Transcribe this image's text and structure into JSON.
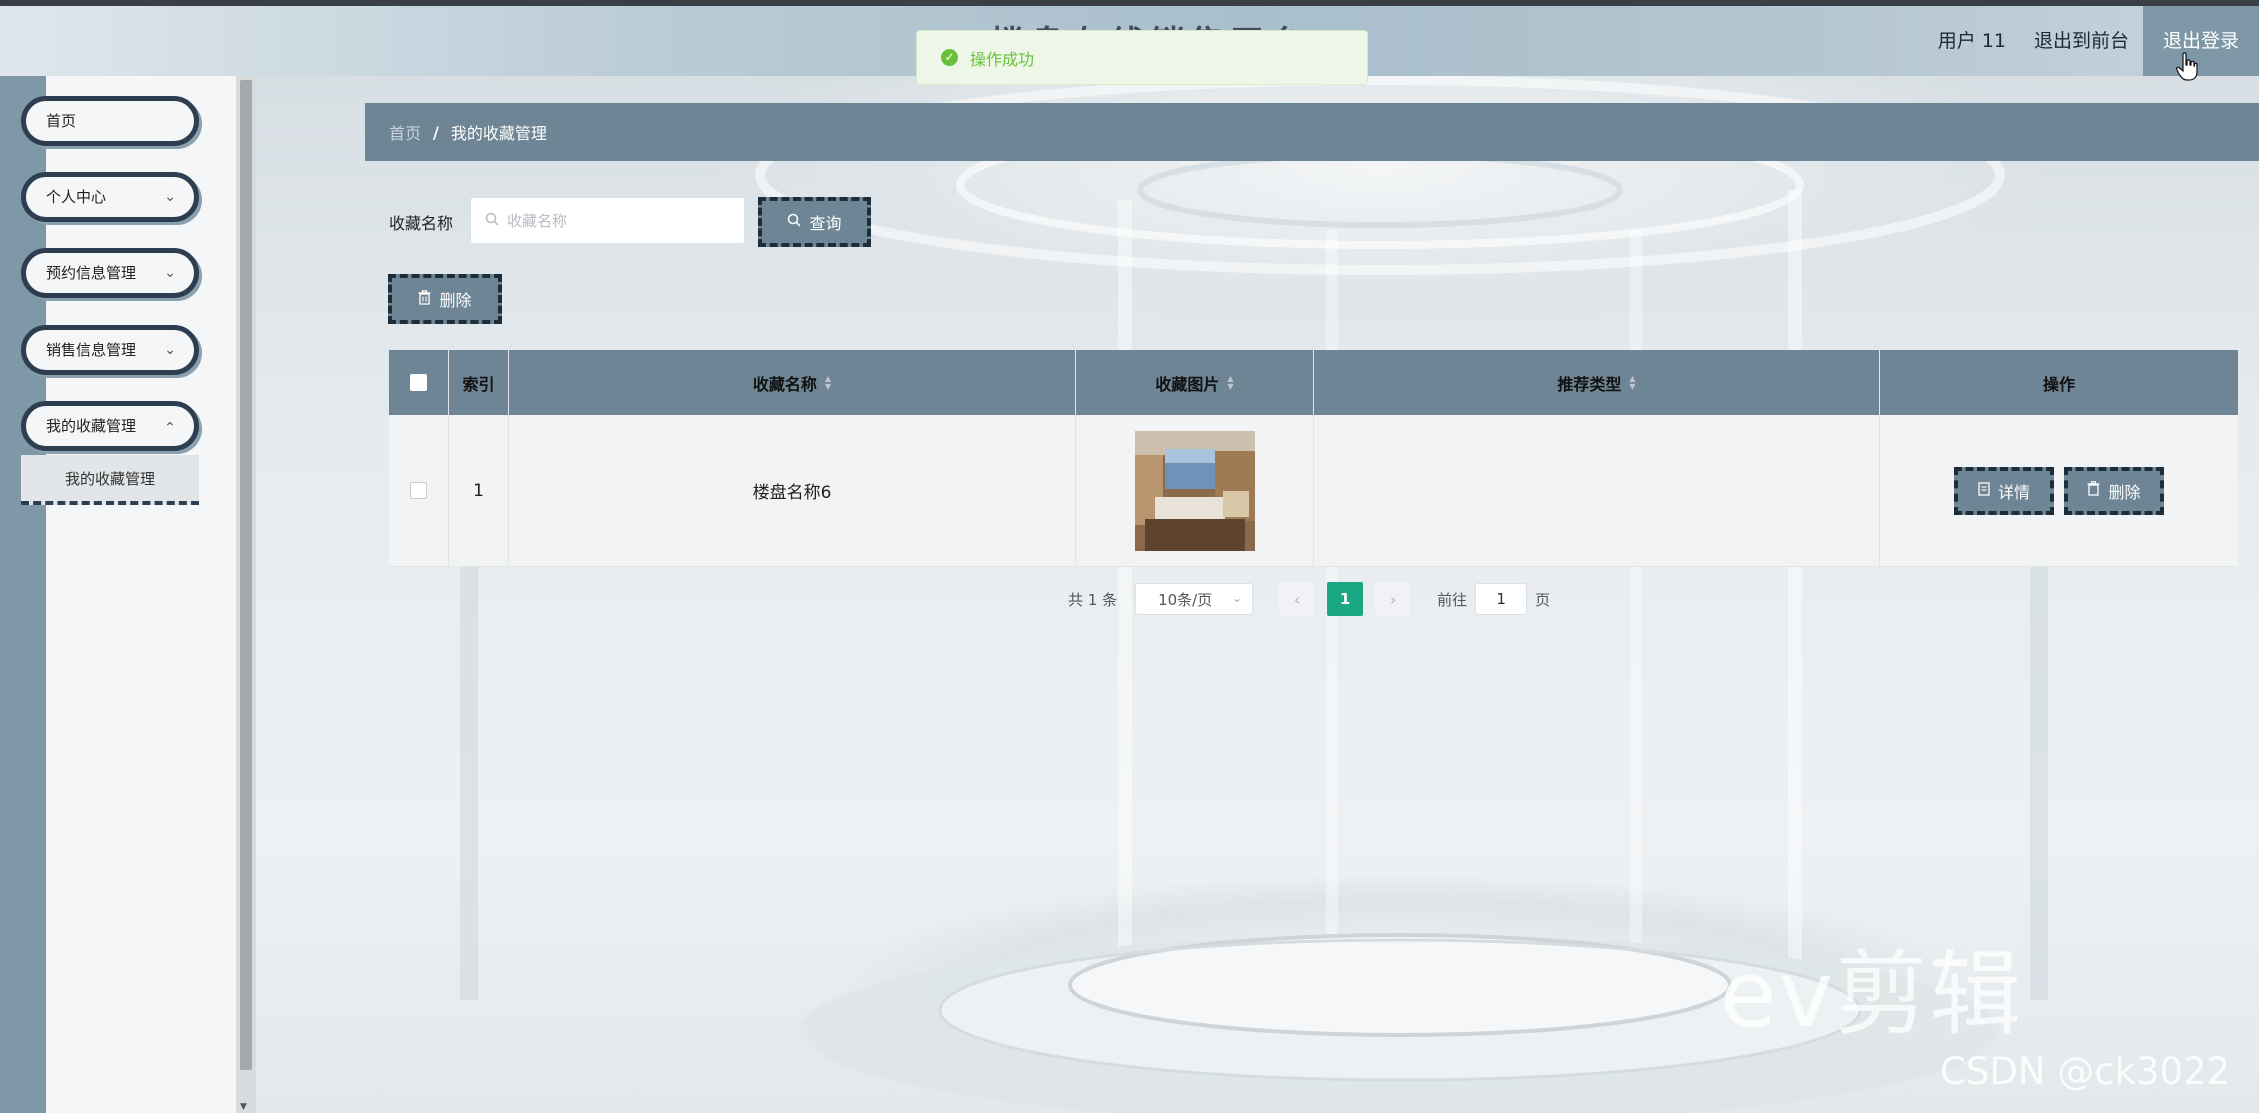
{
  "header": {
    "title": "楼盘在线销售平台",
    "user": "用户 11",
    "back_to_front": "退出到前台",
    "logout": "退出登录"
  },
  "toast": {
    "message": "操作成功"
  },
  "sidebar": {
    "items": [
      {
        "label": "首页"
      },
      {
        "label": "个人中心"
      },
      {
        "label": "预约信息管理"
      },
      {
        "label": "销售信息管理"
      },
      {
        "label": "我的收藏管理"
      }
    ],
    "submenu_active": "我的收藏管理",
    "chevron": "⌄"
  },
  "breadcrumb": {
    "home": "首页",
    "separator": "/",
    "current": "我的收藏管理"
  },
  "search": {
    "label": "收藏名称",
    "placeholder": "收藏名称",
    "query_button": "查询",
    "delete_button": "删除"
  },
  "table": {
    "headers": {
      "index": "索引",
      "name": "收藏名称",
      "image": "收藏图片",
      "type": "推荐类型",
      "ops": "操作"
    },
    "rows": [
      {
        "index": "1",
        "name": "楼盘名称6",
        "type": "",
        "detail_button": "详情",
        "delete_button": "删除"
      }
    ]
  },
  "pagination": {
    "total": "共 1 条",
    "page_size": "10条/页",
    "current_page": "1",
    "goto_label": "前往",
    "goto_value": "1",
    "page_suffix": "页"
  },
  "watermarks": {
    "editor": "ev剪辑",
    "csdn": "CSDN @ck3022"
  },
  "colors": {
    "primary": "#6d8594",
    "rail": "#7f98a8",
    "dashed_border": "#1d2d3a",
    "success": "#67c23a",
    "page_active": "#1ba784"
  }
}
